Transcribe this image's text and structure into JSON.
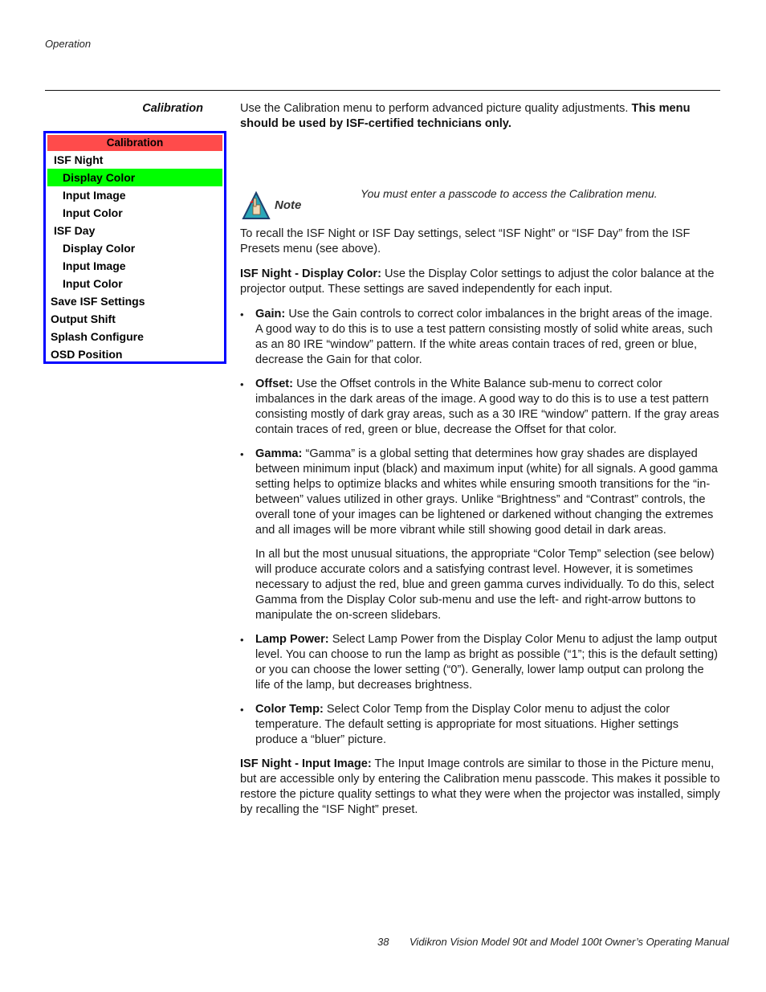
{
  "header": {
    "running_head": "Operation",
    "section_heading": "Calibration"
  },
  "osd_menu": {
    "title": "Calibration",
    "colors": {
      "border": "#0000ff",
      "title_bg": "#ff4b4b",
      "selected_bg": "#00ff00"
    },
    "items": [
      {
        "label": "ISF Night",
        "level": 1,
        "selected": false
      },
      {
        "label": "Display Color",
        "level": 2,
        "selected": true
      },
      {
        "label": "Input Image",
        "level": 2,
        "selected": false
      },
      {
        "label": "Input Color",
        "level": 2,
        "selected": false
      },
      {
        "label": "ISF Day",
        "level": 1,
        "selected": false
      },
      {
        "label": "Display Color",
        "level": 2,
        "selected": false
      },
      {
        "label": "Input Image",
        "level": 2,
        "selected": false
      },
      {
        "label": "Input Color",
        "level": 2,
        "selected": false
      },
      {
        "label": "Save ISF Settings",
        "level": 0,
        "selected": false
      },
      {
        "label": "Output Shift",
        "level": 0,
        "selected": false
      },
      {
        "label": "Splash Configure",
        "level": 0,
        "selected": false
      },
      {
        "label": "OSD Position",
        "level": 0,
        "selected": false
      }
    ]
  },
  "intro": {
    "text": "Use the Calibration menu to perform advanced picture quality adjustments. ",
    "bold": "This menu should be used by ISF-certified technicians only."
  },
  "note": {
    "icon": "note-hand-icon",
    "label": "Note",
    "text": "You must enter a passcode to access the Calibration menu."
  },
  "recall_paragraph": "To recall the ISF Night or ISF Day settings, select “ISF Night” or “ISF Day” from the ISF Presets menu (see above).",
  "display_color": {
    "title": "ISF Night - Display Color:",
    "text": " Use the Display Color settings to adjust the color balance at the projector output. These settings are saved independently for each input."
  },
  "bullets": [
    {
      "term": "Gain:",
      "text": " Use the Gain controls to correct color imbalances in the bright areas of the image. A good way to do this is to use a test pattern consisting mostly of solid white areas, such as an 80 IRE “window” pattern. If the white areas contain traces of red, green or blue, decrease the Gain for that color."
    },
    {
      "term": "Offset:",
      "text": " Use the Offset controls in the White Balance sub-menu to correct color imbalances in the dark areas of the image. A good way to do this is to use a test pattern consisting mostly of dark gray areas, such as a 30 IRE “window” pattern. If the gray areas contain traces of red, green or blue, decrease the Offset for that color."
    },
    {
      "term": "Gamma:",
      "text": " “Gamma” is a global setting that determines how gray shades are displayed between minimum input (black) and maximum input (white) for all signals. A good gamma setting helps to optimize blacks and whites while ensuring smooth transitions for the “in-between” values utilized in other grays. Unlike “Brightness” and “Contrast” controls, the overall tone of your images can be lightened or darkened without changing the extremes and all images will be more vibrant while still showing good detail in dark areas."
    }
  ],
  "gamma_followup": "In all but the most unusual situations, the appropriate “Color Temp” selection (see below) will produce accurate colors and a satisfying contrast level. However, it is sometimes necessary to adjust the red, blue and green gamma curves individually. To do this, select Gamma from the Display Color sub-menu and use the left- and right-arrow buttons to manipulate the on-screen slidebars.",
  "bullets2": [
    {
      "term": "Lamp Power:",
      "text": " Select Lamp Power from the Display Color Menu to adjust the lamp output level. You can choose to run the lamp as bright as possible (“1”; this is the default setting) or you can choose the lower setting (“0”). Generally, lower lamp output can prolong the life of the lamp, but decreases brightness."
    },
    {
      "term": "Color Temp:",
      "text": " Select Color Temp from the Display Color menu to adjust the color temperature. The default setting is appropriate for most situations. Higher settings produce a “bluer” picture."
    }
  ],
  "input_image": {
    "title": "ISF Night - Input Image:",
    "text": " The Input Image controls are similar to those in the Picture menu, but are accessible only by entering the Calibration menu passcode. This makes it possible to restore the picture quality settings to what they were when the projector was installed, simply by recalling the “ISF Night” preset."
  },
  "footer": {
    "page_number": "38",
    "manual_title": "Vidikron Vision Model 90t and Model 100t Owner’s Operating Manual"
  }
}
